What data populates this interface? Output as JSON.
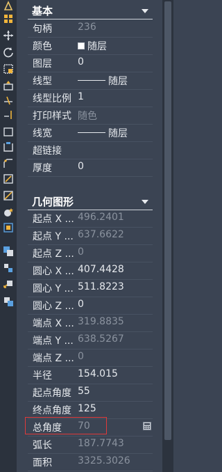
{
  "toolbar": {
    "icons": [
      "draw-icon",
      "grid-icon",
      "move-icon",
      "rotate-icon",
      "scale-icon",
      "stretch-icon",
      "trim-icon",
      "extend-icon",
      "break-icon",
      "join-icon",
      "chamfer-icon",
      "fillet-icon",
      "explode-icon",
      "array-icon",
      "offset-icon",
      "copy-icon",
      "mirror-icon",
      "align-icon",
      "properties-icon"
    ]
  },
  "sections": {
    "basic": {
      "title": "基本",
      "rows": [
        {
          "label": "句柄",
          "value": "236",
          "dim": true
        },
        {
          "label": "颜色",
          "value": "随层"
        },
        {
          "label": "图层",
          "value": "0"
        },
        {
          "label": "线型",
          "value": "随层"
        },
        {
          "label": "线型比例",
          "value": "1"
        },
        {
          "label": "打印样式",
          "value": "随色",
          "dim": true
        },
        {
          "label": "线宽",
          "value": "随层"
        },
        {
          "label": "超链接",
          "value": ""
        },
        {
          "label": "厚度",
          "value": "0"
        }
      ]
    },
    "geometry": {
      "title": "几何图形",
      "rows": [
        {
          "label": "起点 X ...",
          "value": "496.2401",
          "dim": true
        },
        {
          "label": "起点 Y ...",
          "value": "637.6622",
          "dim": true
        },
        {
          "label": "起点 Z ...",
          "value": "0",
          "dim": true
        },
        {
          "label": "圆心 X ...",
          "value": "407.4428"
        },
        {
          "label": "圆心 Y ...",
          "value": "511.8223"
        },
        {
          "label": "圆心 Z ...",
          "value": "0"
        },
        {
          "label": "端点 X ...",
          "value": "319.8835",
          "dim": true
        },
        {
          "label": "端点 Y ...",
          "value": "638.5267",
          "dim": true
        },
        {
          "label": "端点 Z ...",
          "value": "0",
          "dim": true
        },
        {
          "label": "半径",
          "value": "154.015"
        },
        {
          "label": "起点角度",
          "value": "55"
        },
        {
          "label": "终点角度",
          "value": "125"
        },
        {
          "label": "总角度",
          "value": "70",
          "dim": true
        },
        {
          "label": "弧长",
          "value": "187.7743",
          "dim": true
        },
        {
          "label": "面积",
          "value": "3325.3026",
          "dim": true
        }
      ]
    }
  }
}
